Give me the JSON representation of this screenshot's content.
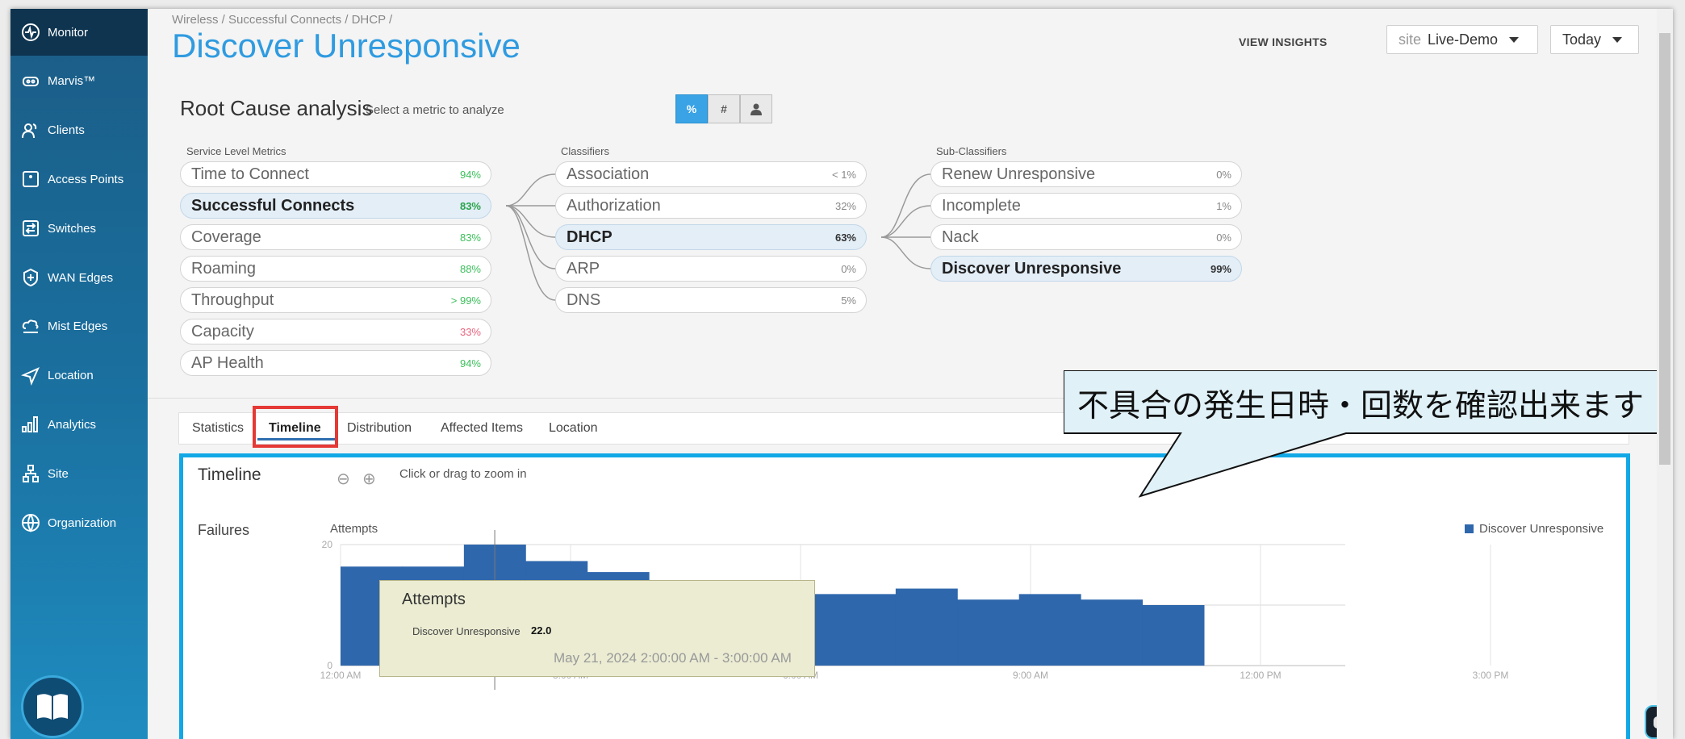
{
  "sidebar": {
    "items": [
      {
        "label": "Monitor",
        "icon": "monitor-icon"
      },
      {
        "label": "Marvis™",
        "icon": "marvis-icon"
      },
      {
        "label": "Clients",
        "icon": "clients-icon"
      },
      {
        "label": "Access Points",
        "icon": "access-point-icon"
      },
      {
        "label": "Switches",
        "icon": "switch-icon"
      },
      {
        "label": "WAN Edges",
        "icon": "wan-edge-icon"
      },
      {
        "label": "Mist Edges",
        "icon": "mist-edge-icon"
      },
      {
        "label": "Location",
        "icon": "location-icon"
      },
      {
        "label": "Analytics",
        "icon": "analytics-icon"
      },
      {
        "label": "Site",
        "icon": "site-icon"
      },
      {
        "label": "Organization",
        "icon": "organization-icon"
      }
    ],
    "active": "Monitor"
  },
  "header": {
    "breadcrumb": "Wireless / Successful Connects / DHCP /",
    "title": "Discover Unresponsive",
    "view_insights": "VIEW INSIGHTS",
    "site_prefix": "site",
    "site_value": "Live-Demo",
    "date_value": "Today"
  },
  "rca": {
    "title": "Root Cause analysis",
    "subtitle": "Select a metric to analyze",
    "toggle": [
      "%",
      "#",
      "user-icon"
    ],
    "columns": {
      "service": {
        "heading": "Service Level Metrics",
        "items": [
          {
            "label": "Time to Connect",
            "value": "94%",
            "color": "#3bbf5a"
          },
          {
            "label": "Successful Connects",
            "value": "83%",
            "color": "#2aa44a",
            "selected": true
          },
          {
            "label": "Coverage",
            "value": "83%",
            "color": "#3bbf5a"
          },
          {
            "label": "Roaming",
            "value": "88%",
            "color": "#3bbf5a"
          },
          {
            "label": "Throughput",
            "value": "> 99%",
            "color": "#3bbf5a"
          },
          {
            "label": "Capacity",
            "value": "33%",
            "color": "#e8647e"
          },
          {
            "label": "AP Health",
            "value": "94%",
            "color": "#3bbf5a"
          }
        ]
      },
      "classifiers": {
        "heading": "Classifiers",
        "items": [
          {
            "label": "Association",
            "value": "< 1%"
          },
          {
            "label": "Authorization",
            "value": "32%"
          },
          {
            "label": "DHCP",
            "value": "63%",
            "selected": true
          },
          {
            "label": "ARP",
            "value": "0%"
          },
          {
            "label": "DNS",
            "value": "5%"
          }
        ]
      },
      "subclassifiers": {
        "heading": "Sub-Classifiers",
        "items": [
          {
            "label": "Renew Unresponsive",
            "value": "0%"
          },
          {
            "label": "Incomplete",
            "value": "1%"
          },
          {
            "label": "Nack",
            "value": "0%"
          },
          {
            "label": "Discover Unresponsive",
            "value": "99%",
            "selected": true
          }
        ]
      }
    }
  },
  "tabs": {
    "items": [
      "Statistics",
      "Timeline",
      "Distribution",
      "Affected Items",
      "Location"
    ],
    "active": "Timeline"
  },
  "timeline": {
    "title": "Timeline",
    "zoom_hint": "Click or drag to zoom in",
    "row_label": "Failures",
    "y_label": "Attempts",
    "legend": "Discover Unresponsive",
    "legend_color": "#2f67ac",
    "tooltip": {
      "title": "Attempts",
      "series": "Discover Unresponsive",
      "value": "22.0",
      "range": "May 21, 2024 2:00:00 AM - 3:00:00 AM"
    }
  },
  "chart_data": {
    "type": "area",
    "title": "",
    "ylabel": "Attempts",
    "ylim": [
      0,
      22
    ],
    "x_ticks": [
      "12:00 AM",
      "3:00 AM",
      "6:00 AM",
      "9:00 AM",
      "12:00 PM",
      "3:00 PM"
    ],
    "y_ticks": [
      "0",
      "20"
    ],
    "series": [
      {
        "name": "Discover Unresponsive",
        "color": "#2f67ac",
        "x": [
          "12:00 AM",
          "1:00 AM",
          "2:00 AM",
          "3:00 AM",
          "4:00 AM",
          "5:00 AM",
          "6:00 AM",
          "7:00 AM",
          "8:00 AM",
          "9:00 AM",
          "10:00 AM",
          "11:00 AM",
          "12:00 PM",
          "1:00 PM"
        ],
        "values": [
          18,
          18,
          22,
          19,
          17,
          14,
          14,
          13,
          13,
          14,
          12,
          13,
          12,
          11
        ]
      }
    ],
    "grid": true,
    "legend_position": "top-right"
  },
  "callout": {
    "text": "不具合の発生日時・回数を確認出来ます"
  }
}
